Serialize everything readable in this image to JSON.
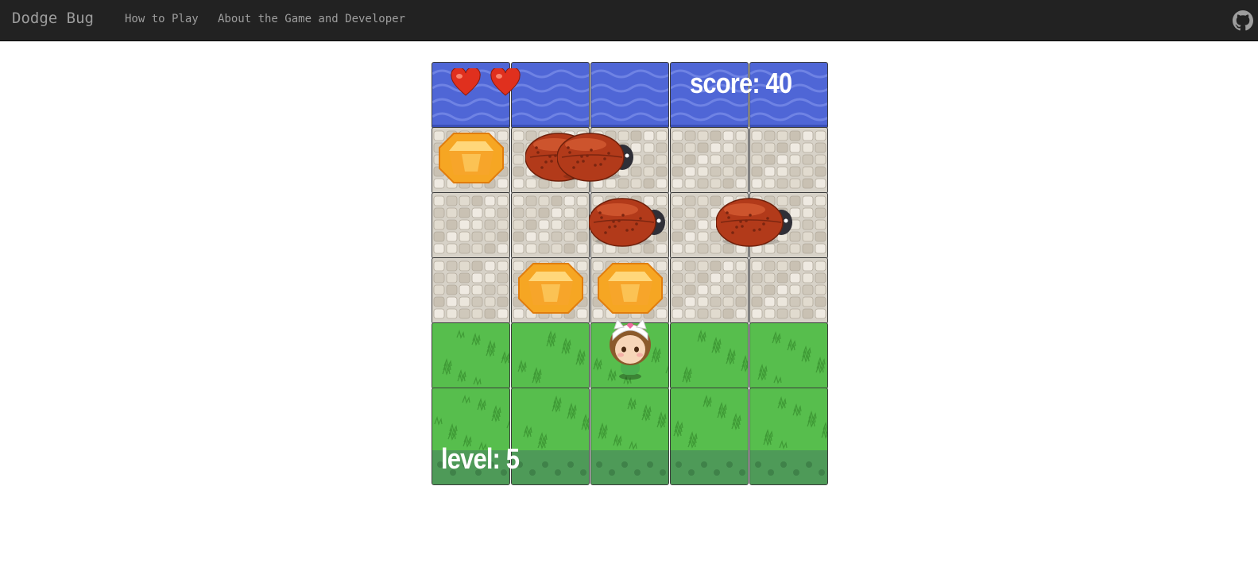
{
  "nav": {
    "brand": "Dodge Bug",
    "links": [
      "How to Play",
      "About the Game and Developer"
    ],
    "github_icon": "github-icon"
  },
  "game": {
    "score_text": "score: 40",
    "level_text": "level: 5",
    "lives": 2,
    "grid": {
      "columns": 5,
      "rows": [
        "water",
        "stone",
        "stone",
        "stone",
        "grass",
        "grass"
      ]
    },
    "gems": [
      {
        "row": 1,
        "col": 0
      },
      {
        "row": 3,
        "col": 1
      },
      {
        "row": 3,
        "col": 2
      }
    ],
    "bugs": [
      {
        "row": 1,
        "col": 1
      },
      {
        "row": 1,
        "col": 1.4
      },
      {
        "row": 2,
        "col": 1.8
      },
      {
        "row": 2,
        "col": 3.4
      }
    ],
    "player": {
      "row": 4,
      "col": 2
    },
    "colors": {
      "water": "#4f66d6",
      "stone": "#d7d2c8",
      "grass": "#57be4d",
      "gem": "#f6a623",
      "bug": "#b23a1a",
      "heart": "#e0301e",
      "nav": "#222222"
    }
  }
}
